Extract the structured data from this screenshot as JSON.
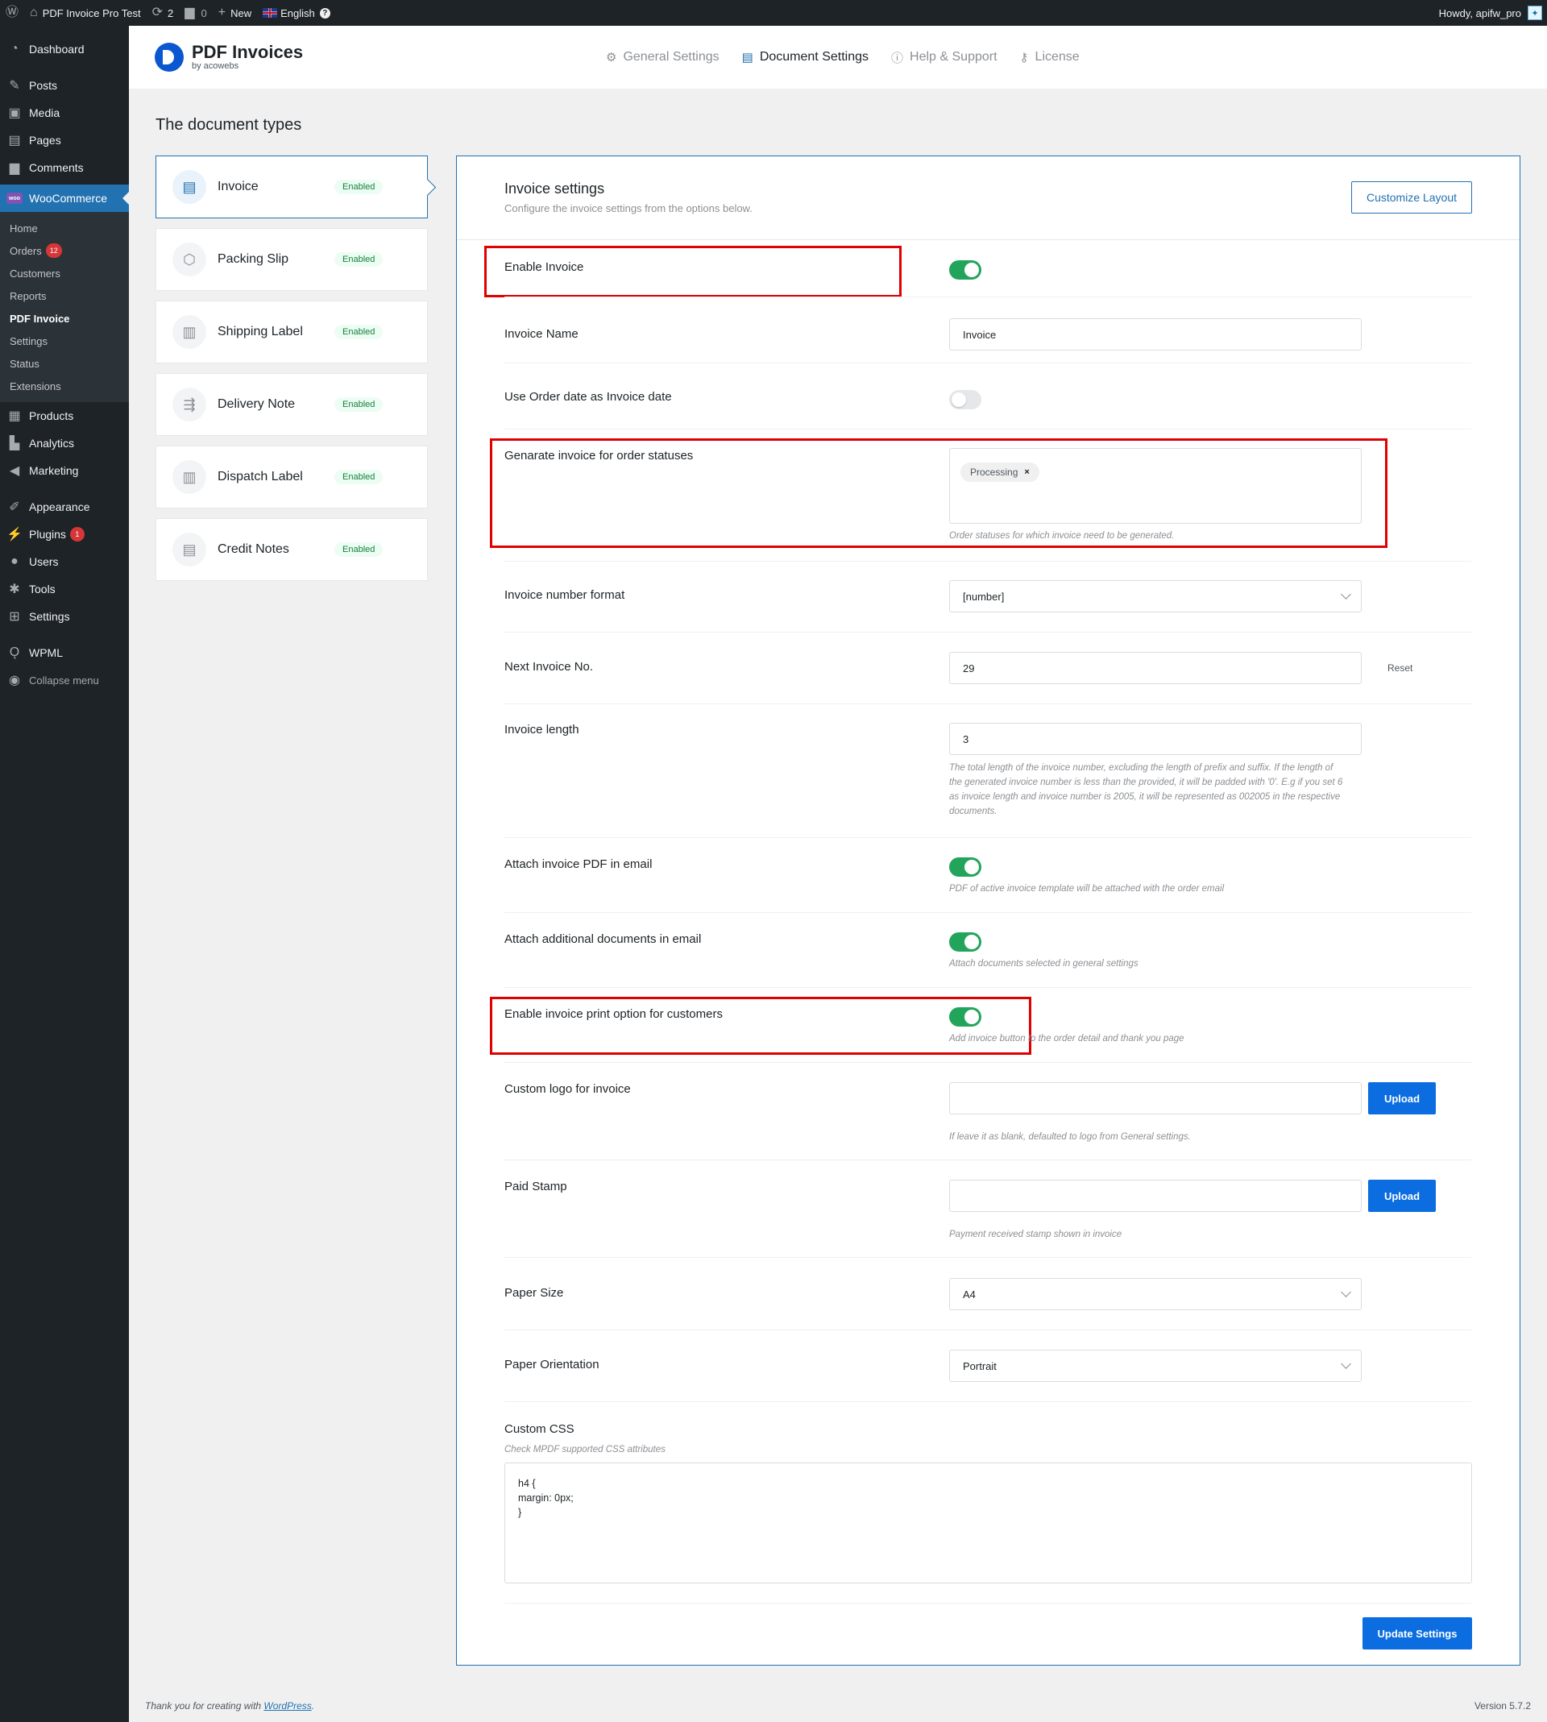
{
  "admin_bar": {
    "site_name": "PDF Invoice Pro Test",
    "updates": "2",
    "comments": "0",
    "new_label": "New",
    "language": "English",
    "greeting": "Howdy, apifw_pro"
  },
  "sidebar": {
    "dashboard": "Dashboard",
    "posts": "Posts",
    "media": "Media",
    "pages": "Pages",
    "comments": "Comments",
    "woocommerce": "WooCommerce",
    "woo_logo": "woo",
    "woo_sub": {
      "home": "Home",
      "orders": "Orders",
      "orders_count": "12",
      "customers": "Customers",
      "reports": "Reports",
      "pdf_invoice": "PDF Invoice",
      "settings": "Settings",
      "status": "Status",
      "extensions": "Extensions"
    },
    "products": "Products",
    "analytics": "Analytics",
    "marketing": "Marketing",
    "appearance": "Appearance",
    "plugins": "Plugins",
    "plugins_count": "1",
    "users": "Users",
    "tools": "Tools",
    "settings": "Settings",
    "wpml": "WPML",
    "collapse": "Collapse menu"
  },
  "header": {
    "brand_title": "PDF Invoices",
    "brand_sub": "by acowebs",
    "tabs": [
      "General Settings",
      "Document Settings",
      "Help & Support",
      "License"
    ],
    "active_tab": "Document Settings"
  },
  "doc_types": {
    "title": "The document types",
    "items": [
      {
        "label": "Invoice",
        "status": "Enabled"
      },
      {
        "label": "Packing Slip",
        "status": "Enabled"
      },
      {
        "label": "Shipping Label",
        "status": "Enabled"
      },
      {
        "label": "Delivery Note",
        "status": "Enabled"
      },
      {
        "label": "Dispatch Label",
        "status": "Enabled"
      },
      {
        "label": "Credit Notes",
        "status": "Enabled"
      }
    ]
  },
  "panel": {
    "title": "Invoice settings",
    "subtitle": "Configure the invoice settings from the options below.",
    "customize_button": "Customize Layout",
    "enable_invoice": {
      "label": "Enable Invoice",
      "on": true
    },
    "invoice_name": {
      "label": "Invoice Name",
      "value": "Invoice"
    },
    "use_order_date": {
      "label": "Use Order date as Invoice date",
      "on": false
    },
    "order_statuses": {
      "label": "Genarate invoice for order statuses",
      "chip": "Processing",
      "help": "Order statuses for which invoice need to be generated."
    },
    "number_format": {
      "label": "Invoice number format",
      "value": "[number]"
    },
    "next_no": {
      "label": "Next Invoice No.",
      "value": "29",
      "reset": "Reset"
    },
    "invoice_length": {
      "label": "Invoice length",
      "value": "3",
      "help_lines": [
        "The total length of the invoice number, excluding the length of prefix and suffix. If the length of",
        "the generated invoice number is less than the provided, it will be padded with '0'. E.g if you set 6",
        "as invoice length and invoice number is 2005, it will be represented as 002005 in the respective",
        "documents."
      ]
    },
    "attach_pdf": {
      "label": "Attach invoice PDF in email",
      "on": true,
      "help": "PDF of active invoice template will be attached with the order email"
    },
    "attach_additional": {
      "label": "Attach additional documents in email",
      "on": true,
      "help": "Attach documents selected in general settings"
    },
    "print_option": {
      "label": "Enable invoice print option for customers",
      "on": true,
      "help": "Add invoice button to the order detail and thank you page"
    },
    "custom_logo": {
      "label": "Custom logo for invoice",
      "button": "Upload",
      "help": "If leave it as blank, defaulted to logo from General settings."
    },
    "paid_stamp": {
      "label": "Paid Stamp",
      "button": "Upload",
      "help": "Payment received stamp shown in invoice"
    },
    "paper_size": {
      "label": "Paper Size",
      "value": "A4"
    },
    "paper_orientation": {
      "label": "Paper Orientation",
      "value": "Portrait"
    },
    "custom_css": {
      "label": "Custom CSS",
      "help": "Check MPDF supported CSS attributes",
      "value": "h4 {\nmargin: 0px;\n}"
    },
    "update_button": "Update Settings"
  },
  "footer": {
    "thanks_prefix": "Thank you for creating with ",
    "thanks_link": "WordPress",
    "thanks_suffix": ".",
    "version": "Version 5.7.2"
  },
  "colors": {
    "accent": "#2271b1",
    "toggle_on": "#22a55a",
    "highlight": "#e00000",
    "admin_dark": "#1d2327"
  }
}
